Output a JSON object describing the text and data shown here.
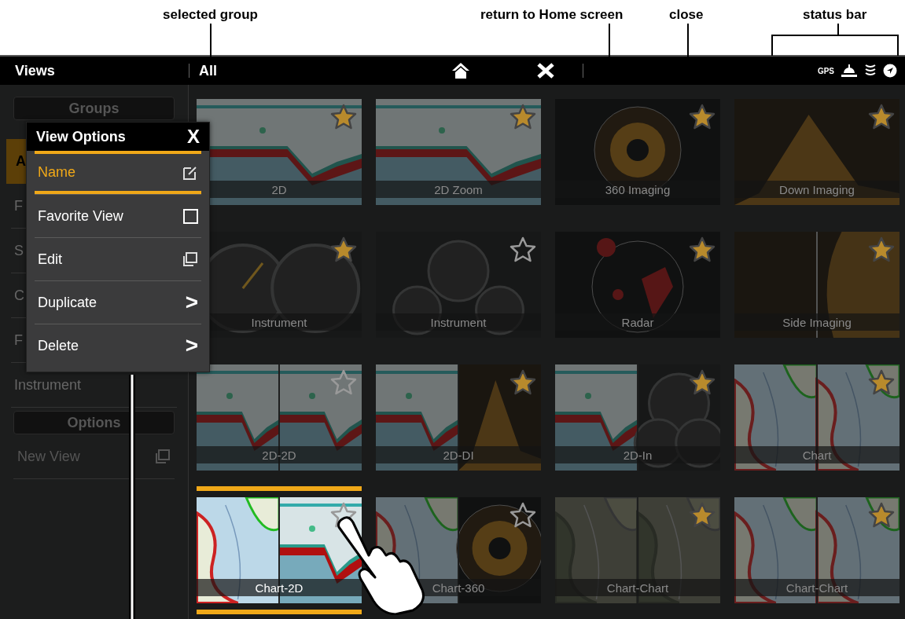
{
  "annotations": [
    {
      "text": "selected group"
    },
    {
      "text": "return to Home screen"
    },
    {
      "text": "close"
    },
    {
      "text": "status bar"
    }
  ],
  "title_bar": {
    "title": "Views",
    "group": "All",
    "gps": "GPS"
  },
  "sidebar": {
    "groups_header": "Groups",
    "items": [
      {
        "label": "A",
        "selected": true
      },
      {
        "label": "F",
        "selected": false
      },
      {
        "label": "S",
        "selected": false
      },
      {
        "label": "C",
        "selected": false
      },
      {
        "label": "F",
        "selected": false
      },
      {
        "label": "Instrument",
        "selected": false
      }
    ],
    "options_header": "Options",
    "options": [
      {
        "label": "New View"
      }
    ]
  },
  "popup": {
    "title": "View Options",
    "close": "X",
    "items": [
      {
        "label": "Name",
        "kind": "edit",
        "selected": true
      },
      {
        "label": "Favorite View",
        "kind": "checkbox",
        "checked": false,
        "selected": false
      },
      {
        "label": "Edit",
        "kind": "copy",
        "selected": false
      },
      {
        "label": "Duplicate",
        "kind": "submenu",
        "arrow": ">",
        "selected": false
      },
      {
        "label": "Delete",
        "kind": "submenu",
        "arrow": ">",
        "selected": false
      }
    ]
  },
  "views": [
    {
      "label": "2D",
      "favorite": true,
      "selected": false
    },
    {
      "label": "2D Zoom",
      "favorite": true,
      "selected": false
    },
    {
      "label": "360 Imaging",
      "favorite": true,
      "selected": false
    },
    {
      "label": "Down Imaging",
      "favorite": true,
      "selected": false
    },
    {
      "label": "Instrument",
      "favorite": true,
      "selected": false
    },
    {
      "label": "Instrument",
      "favorite": false,
      "selected": false
    },
    {
      "label": "Radar",
      "favorite": true,
      "selected": false
    },
    {
      "label": "Side Imaging",
      "favorite": true,
      "selected": false
    },
    {
      "label": "2D-2D",
      "favorite": false,
      "selected": false
    },
    {
      "label": "2D-DI",
      "favorite": true,
      "selected": false
    },
    {
      "label": "2D-In",
      "favorite": true,
      "selected": false
    },
    {
      "label": "Chart",
      "favorite": true,
      "selected": false
    },
    {
      "label": "Chart-2D",
      "favorite": false,
      "selected": true
    },
    {
      "label": "Chart-360",
      "favorite": false,
      "selected": false
    },
    {
      "label": "Chart-Chart",
      "favorite": true,
      "selected": false
    },
    {
      "label": "Chart-Chart",
      "favorite": true,
      "selected": false
    }
  ]
}
